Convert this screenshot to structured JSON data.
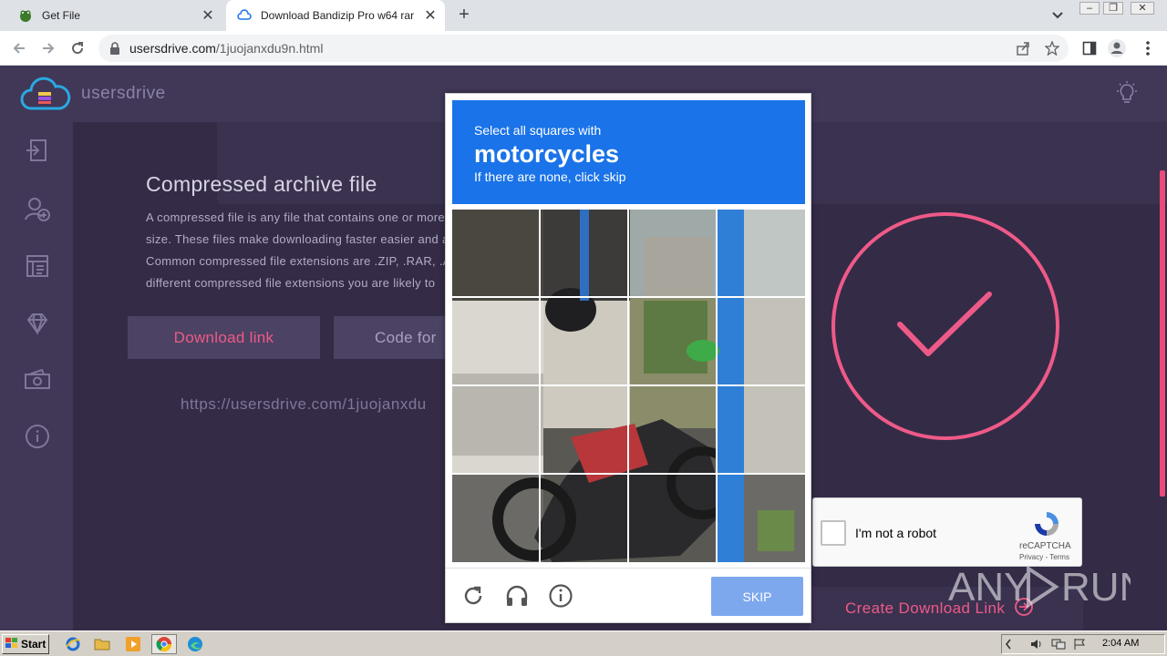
{
  "browser": {
    "tabs": [
      {
        "title": "Get File",
        "active": false
      },
      {
        "title": "Download Bandizip Pro w64 rar",
        "active": true
      }
    ],
    "url_host": "usersdrive.com",
    "url_path": "/1juojanxdu9n.html"
  },
  "site": {
    "brand": "usersdrive",
    "section_title": "Compressed archive file",
    "description_lines": [
      "A compressed file is any file that contains one or more",
      "size. These files make downloading faster easier and al",
      "Common compressed file extensions are .ZIP, .RAR, .AR",
      "different compressed file extensions you are likely to"
    ],
    "download_link_button": "Download link",
    "code_button": "Code for",
    "share_url": "https://usersdrive.com/1juojanxdu",
    "create_download_link": "Create Download Link",
    "sidebar_icons": [
      "login-icon",
      "add-user-icon",
      "invoice-icon",
      "diamond-icon",
      "money-icon",
      "info-icon"
    ],
    "accent_color": "#ee5a88"
  },
  "captcha": {
    "instruction": "Select all squares with",
    "target": "motorcycles",
    "hint": "If there are none, click skip",
    "skip_label": "SKIP",
    "anchor_label": "I'm not a robot",
    "anchor_brand": "reCAPTCHA",
    "anchor_terms": "Privacy - Terms",
    "header_color": "#1a73e8"
  },
  "watermark": "ANY RUN",
  "taskbar": {
    "start_label": "Start",
    "apps": [
      "ie-icon",
      "folder-icon",
      "media-player-icon",
      "chrome-icon",
      "edge-icon"
    ],
    "clock": "2:04 AM"
  }
}
